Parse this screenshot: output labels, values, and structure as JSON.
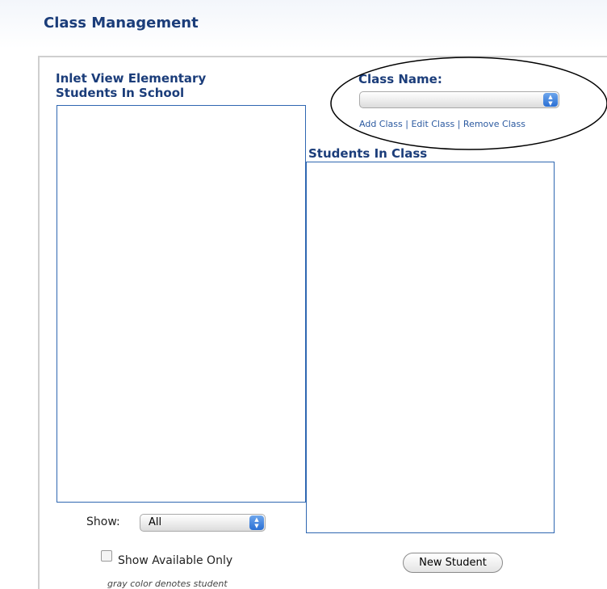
{
  "page": {
    "title": "Class Management"
  },
  "school": {
    "heading_line1": "Inlet View Elementary",
    "heading_line2": "Students In School"
  },
  "class_selector": {
    "label": "Class Name:",
    "selected_value": "",
    "links": [
      "Add Class",
      "Edit Class",
      "Remove Class"
    ],
    "separator": "|"
  },
  "class_list": {
    "heading": "Students In Class"
  },
  "filters": {
    "show_label": "Show:",
    "show_value": "All",
    "available_only_label": "Show Available Only",
    "available_only_checked": false
  },
  "actions": {
    "new_student_label": "New Student"
  },
  "footnote": "gray color denotes student"
}
